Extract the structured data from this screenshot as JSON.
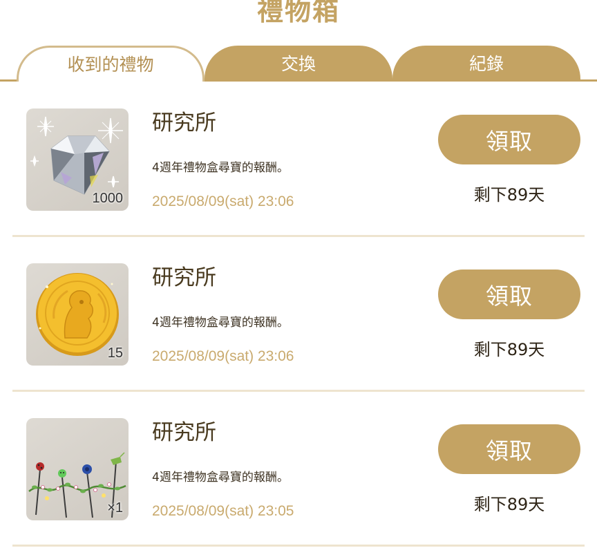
{
  "page": {
    "title": "禮物箱"
  },
  "tabs": [
    {
      "label": "收到的禮物",
      "active": true
    },
    {
      "label": "交換",
      "active": false
    },
    {
      "label": "紀錄",
      "active": false
    }
  ],
  "gifts": [
    {
      "icon": "diamond-icon",
      "quantity": "1000",
      "sender": "研究所",
      "description": "4週年禮物盒尋寶的報酬。",
      "date": "2025/08/09(sat) 23:06",
      "claim_label": "領取",
      "remaining": "剩下89天"
    },
    {
      "icon": "gold-coin-icon",
      "quantity": "15",
      "sender": "研究所",
      "description": "4週年禮物盒尋寶的報酬。",
      "date": "2025/08/09(sat) 23:06",
      "claim_label": "領取",
      "remaining": "剩下89天"
    },
    {
      "icon": "flower-decoration-icon",
      "quantity": "×1",
      "sender": "研究所",
      "description": "4週年禮物盒尋寶的報酬。",
      "date": "2025/08/09(sat) 23:05",
      "claim_label": "領取",
      "remaining": "剩下89天"
    }
  ],
  "colors": {
    "accent": "#c4a363",
    "text_dark": "#4a3b20",
    "date_text": "#c9aa6e",
    "divider": "#eee4cf"
  }
}
